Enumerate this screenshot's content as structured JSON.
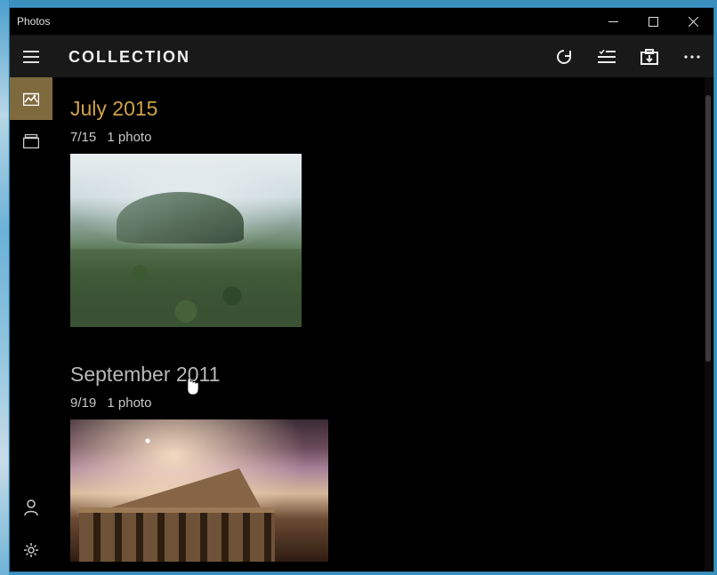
{
  "window": {
    "title": "Photos"
  },
  "commandbar": {
    "page_title": "COLLECTION"
  },
  "groups": [
    {
      "heading": "July 2015",
      "heading_style": "accent",
      "day": "7/15",
      "count_label": "1 photo",
      "thumb_kind": "landscape"
    },
    {
      "heading": "September 2011",
      "heading_style": "dim",
      "day": "9/19",
      "count_label": "1 photo",
      "thumb_kind": "temple"
    }
  ]
}
